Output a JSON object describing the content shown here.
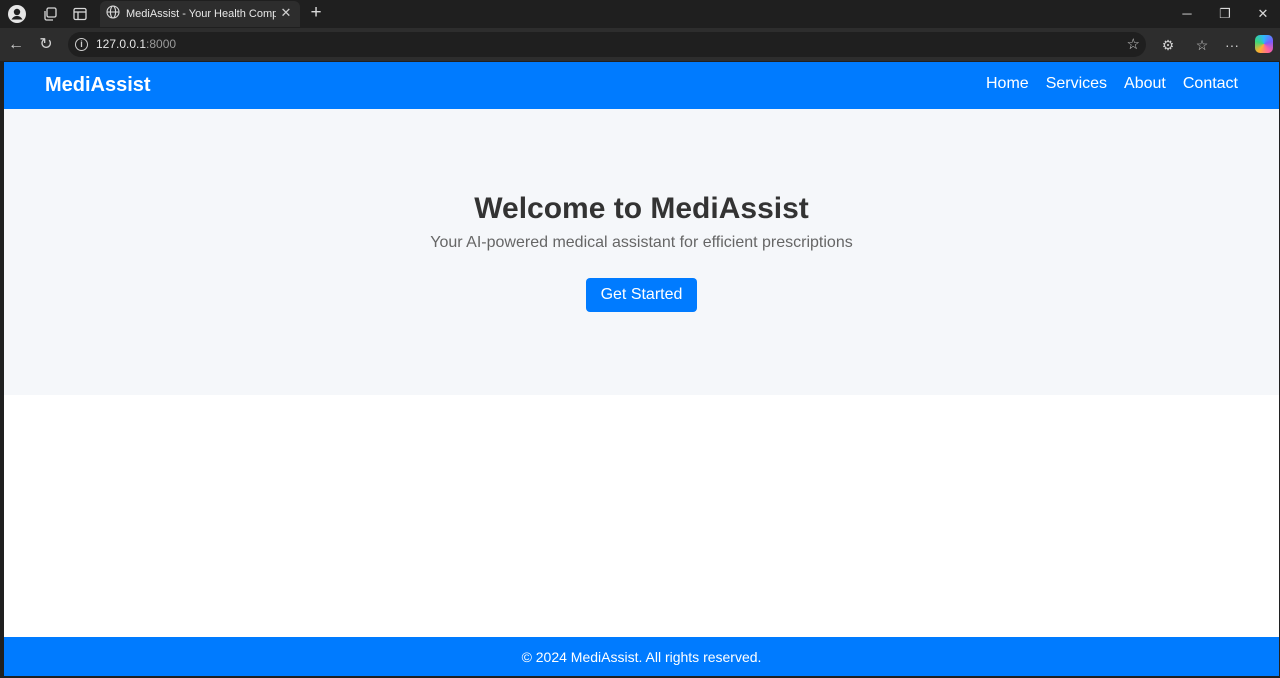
{
  "browser": {
    "tab_title": "MediAssist - Your Health Companion",
    "url_host": "127.0.0.1",
    "url_port": ":8000"
  },
  "site": {
    "brand": "MediAssist",
    "nav": [
      "Home",
      "Services",
      "About",
      "Contact"
    ],
    "hero": {
      "title": "Welcome to MediAssist",
      "subtitle": "Your AI-powered medical assistant for efficient prescriptions",
      "cta": "Get Started"
    },
    "footer": "© 2024 MediAssist. All rights reserved."
  },
  "colors": {
    "primary": "#007bff",
    "hero_bg": "#f5f7fa",
    "heading": "#333333",
    "subtitle": "#666666"
  }
}
